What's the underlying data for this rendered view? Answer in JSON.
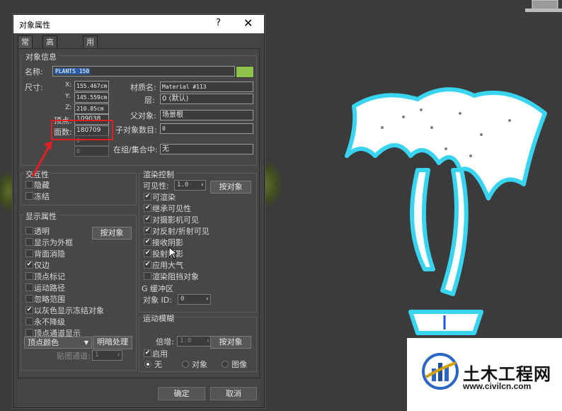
{
  "dialog": {
    "title": "对象属性",
    "help": "?",
    "close": "✕",
    "tabs": [
      "常规",
      "高级照明",
      "用户定义"
    ]
  },
  "object_info": {
    "group_label": "对象信息",
    "name_label": "名称:",
    "name_value": "PLANTS 150",
    "color": "#8fc24a",
    "dims_label": "尺寸:",
    "x_label": "X:",
    "x_value": "155.467cm",
    "y_label": "Y:",
    "y_value": "145.559cm",
    "z_label": "Z:",
    "z_value": "210.85cm",
    "vertices_label": "顶点:",
    "vertices_value": "109038",
    "faces_label": "面数:",
    "faces_value": "180709",
    "extra1": "0",
    "extra2": "0",
    "material_label": "材质名:",
    "material_value": "Material #113",
    "layer_label": "层:",
    "layer_value": "0 (默认)",
    "parent_label": "父对象:",
    "parent_value": "场景根",
    "children_label": "子对象数目:",
    "children_value": "0",
    "ingroup_label": "在组/集合中:",
    "ingroup_value": "无"
  },
  "interactivity": {
    "group_label": "交互性",
    "hide_label": "隐藏",
    "freeze_label": "冻结"
  },
  "display": {
    "group_label": "显示属性",
    "by_object_button": "按对象",
    "items": [
      {
        "label": "透明",
        "checked": false
      },
      {
        "label": "显示为外框",
        "checked": false
      },
      {
        "label": "背面消隐",
        "checked": false
      },
      {
        "label": "仅边",
        "checked": true
      },
      {
        "label": "顶点标记",
        "checked": false
      },
      {
        "label": "运动路径",
        "checked": false
      },
      {
        "label": "忽略范围",
        "checked": false
      },
      {
        "label": "以灰色显示冻结对象",
        "checked": true
      },
      {
        "label": "永不降级",
        "checked": false
      },
      {
        "label": "顶点通道显示",
        "checked": false
      }
    ],
    "vertex_color_dropdown": "顶点颜色",
    "shaded_button": "明暗处理",
    "map_channel_label": "贴图通道:",
    "map_channel_value": "1"
  },
  "render": {
    "group_label": "渲染控制",
    "visibility_label": "可见性:",
    "visibility_value": "1.0",
    "by_object_button": "按对象",
    "items": [
      {
        "label": "可渲染",
        "checked": true
      },
      {
        "label": "继承可见性",
        "checked": true
      },
      {
        "label": "对摄影机可见",
        "checked": true
      },
      {
        "label": "对反射/折射可见",
        "checked": true
      },
      {
        "label": "接收阴影",
        "checked": true
      },
      {
        "label": "投射阴影",
        "checked": true
      },
      {
        "label": "应用大气",
        "checked": true
      },
      {
        "label": "渲染阻挡对象",
        "checked": false
      }
    ],
    "gbuffer_label": "G 缓冲区",
    "object_id_label": "对象 ID:",
    "object_id_value": "0"
  },
  "motion_blur": {
    "group_label": "运动模糊",
    "multiplier_label": "倍增:",
    "multiplier_value": "1.0",
    "by_object_button": "按对象",
    "enabled_label": "启用",
    "enabled_checked": true,
    "options": [
      "无",
      "对象",
      "图像"
    ],
    "selected": "无"
  },
  "footer": {
    "ok": "确定",
    "cancel": "取消"
  },
  "watermark": {
    "title": "土木工程网",
    "url": "www.civilcn.com"
  }
}
